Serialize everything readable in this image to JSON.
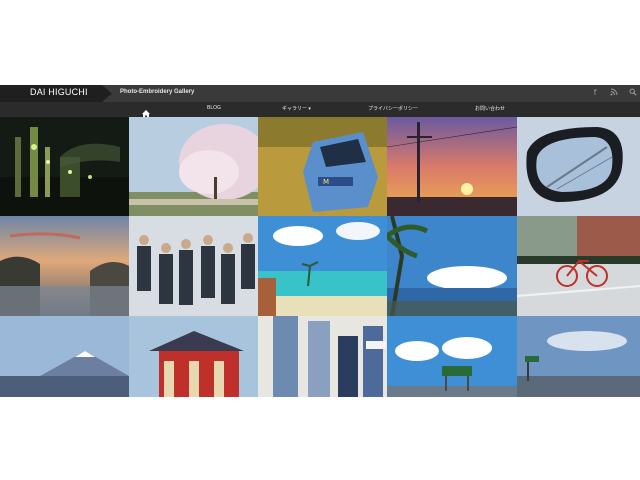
{
  "header": {
    "brand": "DAI HIGUCHI",
    "tagline": "Photo-Embroidery Gallery",
    "icons": [
      "facebook-icon",
      "rss-icon",
      "search-icon"
    ]
  },
  "nav": {
    "home_icon": "home-icon",
    "items": [
      {
        "label": "BLOG"
      },
      {
        "label": "ギャラリー ▾"
      },
      {
        "label": "プライバシーポリシー"
      },
      {
        "label": "お問い合わせ"
      }
    ]
  },
  "gallery": {
    "tiles": [
      {
        "subject": "night-factory-photo"
      },
      {
        "subject": "cherry-blossom-photo"
      },
      {
        "subject": "blue-car-photo"
      },
      {
        "subject": "sunset-utility-pole-photo"
      },
      {
        "subject": "car-mirror-photo"
      },
      {
        "subject": "lake-sunset-photo"
      },
      {
        "subject": "group-of-men-photo"
      },
      {
        "subject": "tropical-beach-photo"
      },
      {
        "subject": "palm-tree-coast-photo"
      },
      {
        "subject": "bicycle-street-photo"
      },
      {
        "subject": "mount-fuji-photo"
      },
      {
        "subject": "red-shrine-photo"
      },
      {
        "subject": "hanging-jeans-photo"
      },
      {
        "subject": "road-sign-clouds-photo"
      },
      {
        "subject": "highway-sky-photo"
      }
    ]
  }
}
